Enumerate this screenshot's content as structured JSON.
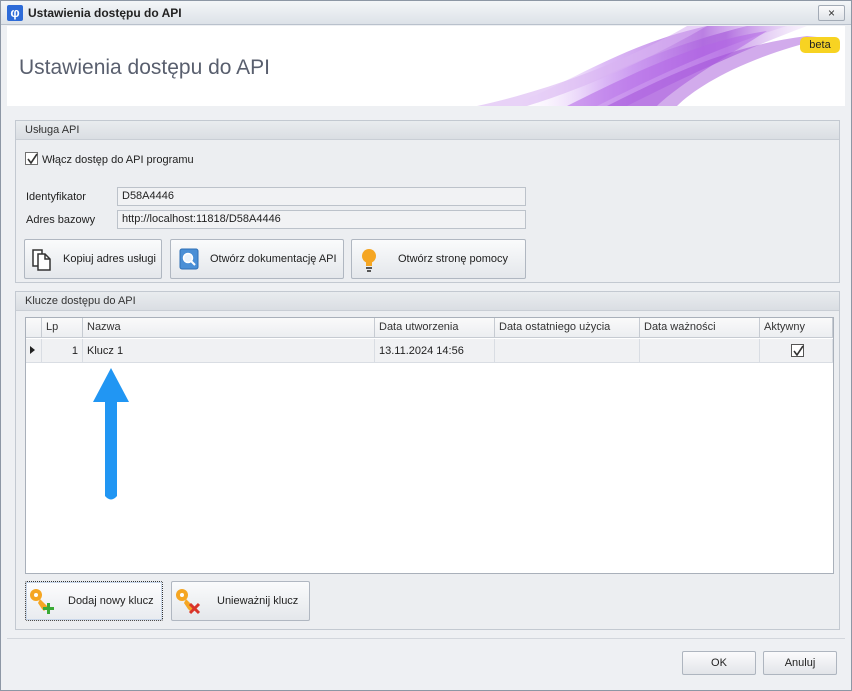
{
  "window": {
    "app_icon_glyph": "φ",
    "title": "Ustawienia dostępu do API",
    "close_glyph": "×"
  },
  "header": {
    "title": "Ustawienia dostępu do API",
    "badge": "beta",
    "accent_color": "#b45ae0"
  },
  "service": {
    "group_title": "Usługa API",
    "enable_label": "Włącz dostęp do API programu",
    "enable_checked": true,
    "identifier_label": "Identyfikator",
    "identifier_value": "D58A4446",
    "base_address_label": "Adres bazowy",
    "base_address_value": "http://localhost:11818/D58A4446",
    "buttons": {
      "copy": {
        "label": "Kopiuj adres usługi",
        "icon": "copy-icon"
      },
      "docs": {
        "label": "Otwórz dokumentację API",
        "icon": "book-search-icon"
      },
      "help": {
        "label": "Otwórz stronę pomocy",
        "icon": "lightbulb-icon"
      }
    }
  },
  "keys": {
    "group_title": "Klucze dostępu do API",
    "columns": {
      "lp": "Lp",
      "name": "Nazwa",
      "created": "Data utworzenia",
      "last_used": "Data ostatniego użycia",
      "expires": "Data ważności",
      "active": "Aktywny"
    },
    "rows": [
      {
        "lp": "1",
        "name": "Klucz 1",
        "created": "13.11.2024 14:56",
        "last_used": "",
        "expires": "",
        "active": true
      }
    ],
    "add_button": "Dodaj nowy klucz",
    "revoke_button": "Unieważnij klucz",
    "annotation_color": "#2196f3"
  },
  "dialog": {
    "ok": "OK",
    "cancel": "Anuluj"
  }
}
